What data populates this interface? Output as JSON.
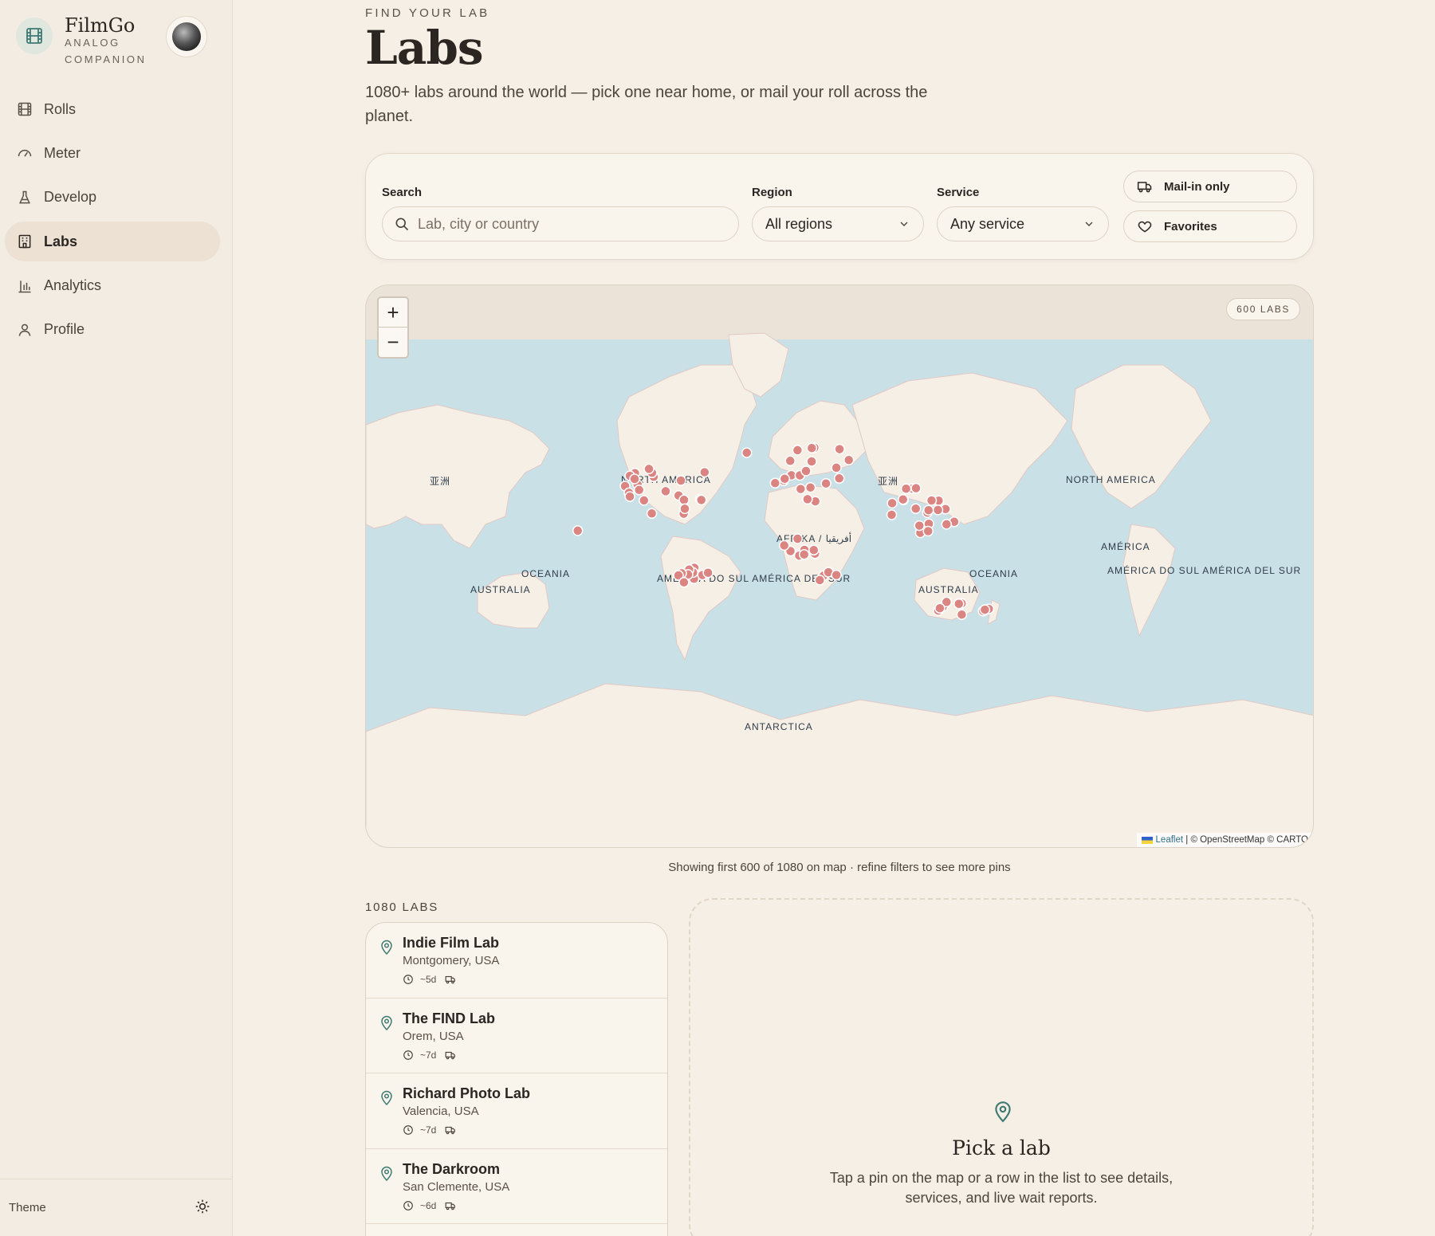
{
  "brand": {
    "name": "FilmGo",
    "tagline": "ANALOG COMPANION"
  },
  "sidebar": {
    "items": [
      {
        "label": "Rolls",
        "icon": "film-icon"
      },
      {
        "label": "Meter",
        "icon": "gauge-icon"
      },
      {
        "label": "Develop",
        "icon": "flask-icon"
      },
      {
        "label": "Labs",
        "icon": "building-icon",
        "active": true
      },
      {
        "label": "Analytics",
        "icon": "bar-chart-icon"
      },
      {
        "label": "Profile",
        "icon": "user-icon"
      }
    ],
    "theme_label": "Theme"
  },
  "header": {
    "eyebrow": "FIND YOUR LAB",
    "title": "Labs",
    "description": "1080+ labs around the world — pick one near home, or mail your roll across the planet."
  },
  "filters": {
    "search_label": "Search",
    "search_placeholder": "Lab, city or country",
    "region_label": "Region",
    "region_value": "All regions",
    "service_label": "Service",
    "service_value": "Any service",
    "mail_in_label": "Mail-in only",
    "favorites_label": "Favorites"
  },
  "map": {
    "zoom_in": "+",
    "zoom_out": "−",
    "pin_count_badge": "600 LABS",
    "attribution_leaflet": "Leaflet",
    "attribution_rest": "| © OpenStreetMap © CARTO",
    "labels": {
      "asia_left": "亚洲",
      "asia_right": "亚洲",
      "north_america": "NORTH AMERICA",
      "north_america_right": "NORTH AMERICA",
      "south_america": "AMÉRICA DO SUL AMÉRICA DEL SUR",
      "south_america_right": "AMÉRICA DO SUL AMÉRICA DEL SUR",
      "america_right": "AMÉRICA",
      "africa": "AFRIKA / أفريقيا",
      "oceania_left": "OCEANIA",
      "oceania_right": "OCEANIA",
      "australia_left": "AUSTRALIA",
      "australia_right": "AUSTRALIA",
      "antarctica": "ANTARCTICA"
    },
    "note": "Showing first 600 of 1080 on map · refine filters to see more pins",
    "pin_color": "#db8583",
    "ocean_color": "#c9e0e6",
    "land_color": "#f5efe6"
  },
  "list": {
    "heading": "1080 LABS",
    "labs": [
      {
        "name": "Indie Film Lab",
        "location": "Montgomery, USA",
        "turnaround": "~5d"
      },
      {
        "name": "The FIND Lab",
        "location": "Orem, USA",
        "turnaround": "~7d"
      },
      {
        "name": "Richard Photo Lab",
        "location": "Valencia, USA",
        "turnaround": "~7d"
      },
      {
        "name": "The Darkroom",
        "location": "San Clemente, USA",
        "turnaround": "~6d"
      }
    ]
  },
  "detail": {
    "title": "Pick a lab",
    "text": "Tap a pin on the map or a row in the list to see details, services, and live wait reports."
  }
}
